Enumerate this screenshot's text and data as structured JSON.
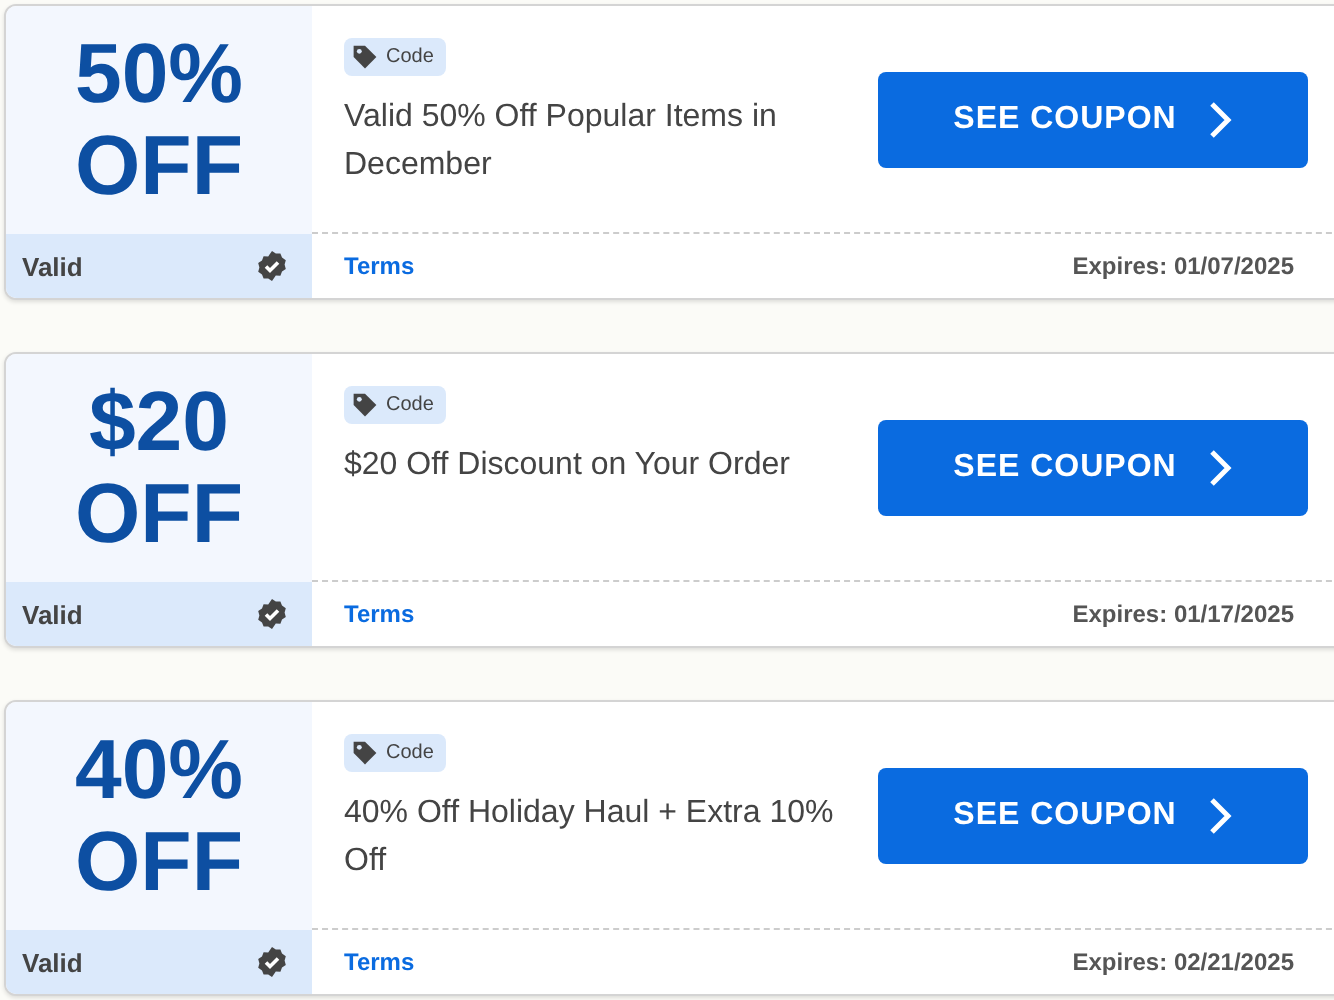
{
  "coupons": [
    {
      "amount": "50%",
      "unit": "OFF",
      "tag": "Code",
      "title": "Valid 50% Off Popular Items in December",
      "button": "SEE COUPON",
      "status": "Valid",
      "verified": true,
      "terms": "Terms",
      "expires": "Expires: 01/07/2025"
    },
    {
      "amount": "$20",
      "unit": "OFF",
      "tag": "Code",
      "title": "$20 Off Discount on Your Order",
      "button": "SEE COUPON",
      "status": "Valid",
      "verified": true,
      "terms": "Terms",
      "expires": "Expires: 01/17/2025"
    },
    {
      "amount": "40%",
      "unit": "OFF",
      "tag": "Code",
      "title": "40% Off Holiday Haul + Extra 10% Off",
      "button": "SEE COUPON",
      "status": "Valid",
      "verified": true,
      "terms": "Terms",
      "expires": "Expires: 02/21/2025"
    }
  ]
}
